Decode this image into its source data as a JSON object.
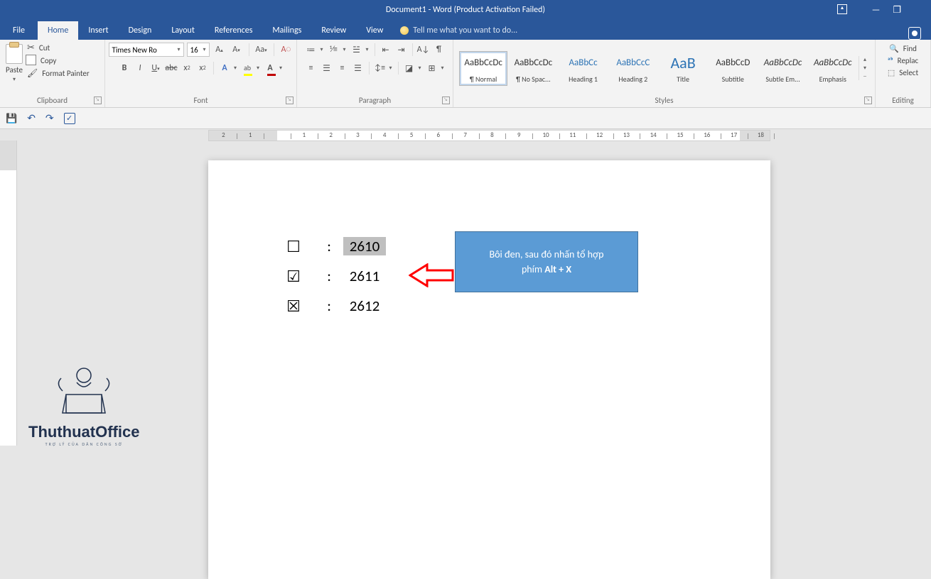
{
  "titlebar": {
    "title": "Document1 - Word (Product Activation Failed)"
  },
  "menu": {
    "file": "File",
    "home": "Home",
    "insert": "Insert",
    "design": "Design",
    "layout": "Layout",
    "references": "References",
    "mailings": "Mailings",
    "review": "Review",
    "view": "View",
    "tellme": "Tell me what you want to do..."
  },
  "ribbon": {
    "clipboard": {
      "label": "Clipboard",
      "paste": "Paste",
      "cut": "Cut",
      "copy": "Copy",
      "format_painter": "Format Painter"
    },
    "font": {
      "label": "Font",
      "name": "Times New Ro",
      "size": "16"
    },
    "paragraph": {
      "label": "Paragraph"
    },
    "styles": {
      "label": "Styles",
      "items": [
        {
          "preview": "AaBbCcDc",
          "name": "¶ Normal"
        },
        {
          "preview": "AaBbCcDc",
          "name": "¶ No Spac..."
        },
        {
          "preview": "AaBbCc",
          "name": "Heading 1"
        },
        {
          "preview": "AaBbCcC",
          "name": "Heading 2"
        },
        {
          "preview": "AaB",
          "name": "Title"
        },
        {
          "preview": "AaBbCcD",
          "name": "Subtitle"
        },
        {
          "preview": "AaBbCcDc",
          "name": "Subtle Em..."
        },
        {
          "preview": "AaBbCcDc",
          "name": "Emphasis"
        }
      ]
    },
    "editing": {
      "label": "Editing",
      "find": "Find",
      "replace": "Replac",
      "select": "Select"
    }
  },
  "document": {
    "lines": [
      {
        "sym": "☐",
        "colon": ":",
        "code": "2610",
        "highlight": true
      },
      {
        "sym": "☑",
        "colon": ":",
        "code": "2611",
        "highlight": false
      },
      {
        "sym": "☒",
        "colon": ":",
        "code": "2612",
        "highlight": false
      }
    ],
    "callout_line1": "Bôi đen, sau đó nhấn tổ hợp",
    "callout_line2_a": "phím ",
    "callout_line2_b": "Alt + X"
  },
  "watermark": {
    "title": "ThuthuatOffice",
    "sub": "TRỢ LÝ CỦA DÂN CÔNG SỞ"
  }
}
